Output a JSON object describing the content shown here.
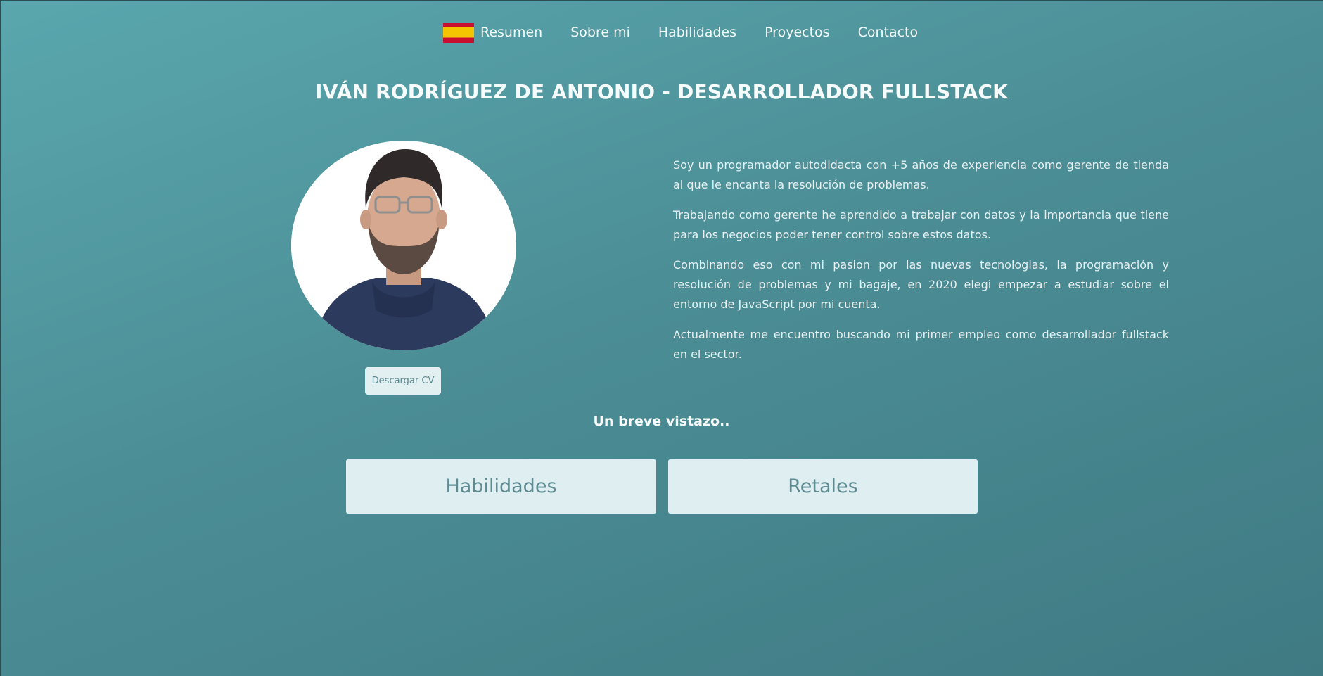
{
  "nav": {
    "flag_icon": "spain-flag-icon",
    "items": [
      {
        "label": "Resumen"
      },
      {
        "label": "Sobre mi"
      },
      {
        "label": "Habilidades"
      },
      {
        "label": "Proyectos"
      },
      {
        "label": "Contacto"
      }
    ]
  },
  "header": {
    "title": "IVÁN RODRÍGUEZ DE ANTONIO - DESARROLLADOR FULLSTACK"
  },
  "profile": {
    "download_cv_label": "Descargar CV"
  },
  "bio": {
    "paragraphs": [
      "Soy un programador autodidacta con +5 años de experiencia como gerente de tienda al que le encanta la resolución de problemas.",
      "Trabajando como gerente he aprendido a trabajar con datos y la importancia que tiene para los negocios poder tener control sobre estos datos.",
      "Combinando eso con mi pasion por las nuevas tecnologias, la programación y resolución de problemas y mi bagaje, en 2020 elegi empezar a estudiar sobre el entorno de JavaScript por mi cuenta.",
      "Actualmente me encuentro buscando mi primer empleo como desarrollador fullstack en el sector."
    ]
  },
  "overview": {
    "subtitle": "Un breve vistazo..",
    "cards": [
      {
        "label": "Habilidades"
      },
      {
        "label": "Retales"
      }
    ]
  },
  "colors": {
    "background_start": "#5aa7ae",
    "background_end": "#3f7a83",
    "card_bg": "#dfeef0",
    "card_text": "#5e8b91",
    "flag_red": "#c8102e",
    "flag_yellow": "#f5c400"
  }
}
